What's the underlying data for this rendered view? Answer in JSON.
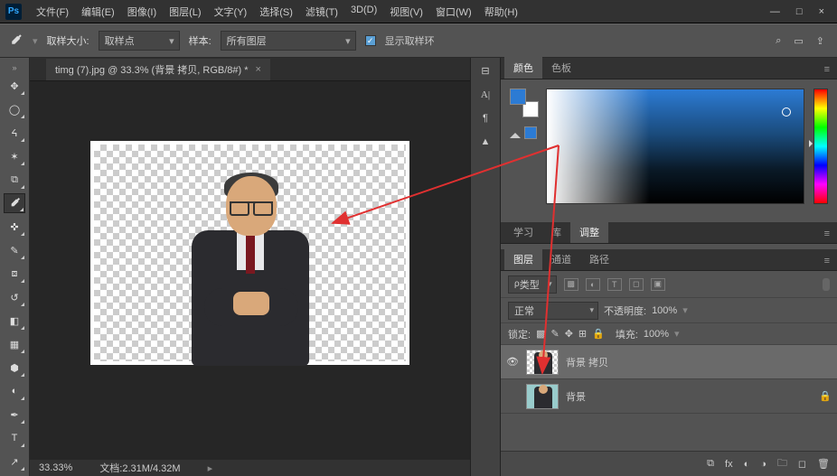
{
  "titlebar": {
    "menus": [
      "文件(F)",
      "编辑(E)",
      "图像(I)",
      "图层(L)",
      "文字(Y)",
      "选择(S)",
      "滤镜(T)",
      "3D(D)",
      "视图(V)",
      "窗口(W)",
      "帮助(H)"
    ]
  },
  "optbar": {
    "sample_size_label": "取样大小:",
    "sample_size_value": "取样点",
    "sample_label": "样本:",
    "sample_value": "所有图层",
    "show_ring": "显示取样环"
  },
  "document": {
    "tab_title": "timg (7).jpg @ 33.3% (背景 拷贝, RGB/8#) *",
    "zoom": "33.33%",
    "docinfo": "文档:2.31M/4.32M"
  },
  "panels": {
    "color_tabs": [
      "颜色",
      "色板"
    ],
    "mid_tabs": [
      "学习",
      "库",
      "调整"
    ],
    "layer_tabs": [
      "图层",
      "通道",
      "路径"
    ],
    "layer_filter": "类型",
    "blend_mode": "正常",
    "opacity_label": "不透明度:",
    "opacity_value": "100%",
    "lock_label": "锁定:",
    "fill_label": "填充:",
    "fill_value": "100%",
    "layers": [
      {
        "name": "背景 拷贝",
        "visible": true,
        "selected": true,
        "locked": false
      },
      {
        "name": "背景",
        "visible": false,
        "selected": false,
        "locked": true
      }
    ]
  }
}
